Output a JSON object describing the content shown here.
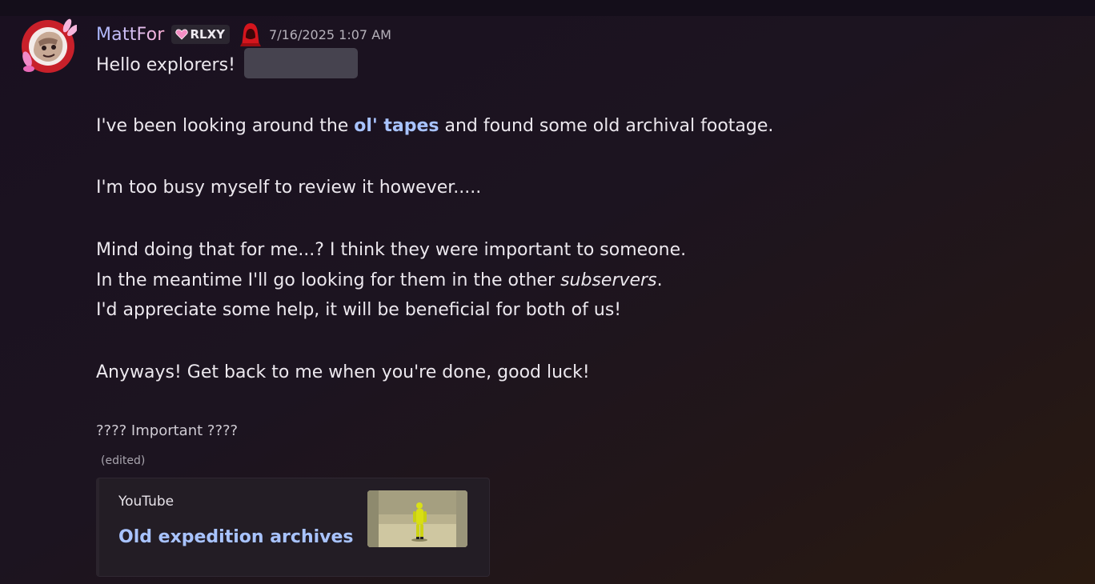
{
  "message": {
    "username": "MattFor",
    "tag": "RLXY",
    "timestamp": "7/16/2025 1:07 AM",
    "greeting": "Hello explorers!",
    "p1_before": "I've been looking around the ",
    "p1_link": "ol' tapes",
    "p1_after": " and found some old archival footage.",
    "p2": "I'm too busy myself to review it however.....",
    "p3": "Mind doing that for me...? I think they were important to someone.",
    "p4_before": "In the meantime I'll go looking for them in the other ",
    "p4_italic": "subservers",
    "p4_after": ".",
    "p5": "I'd appreciate some help, it will be beneficial for both of us!",
    "p6": "Anyways! Get back to me when you're done, good luck!",
    "important": "???? Important ????",
    "edited": "(edited)"
  },
  "embed": {
    "provider": "YouTube",
    "title": "Old expedition archives"
  },
  "icons": {
    "avatar": "avatar-image",
    "tag_badge": "pink-heart-icon",
    "role": "red-hooded-figure-icon",
    "thumbnail": "video-thumbnail"
  },
  "colors": {
    "link": "#a8c3ff",
    "spoiler": "#46434f",
    "tag_bg": "#2b2630"
  }
}
